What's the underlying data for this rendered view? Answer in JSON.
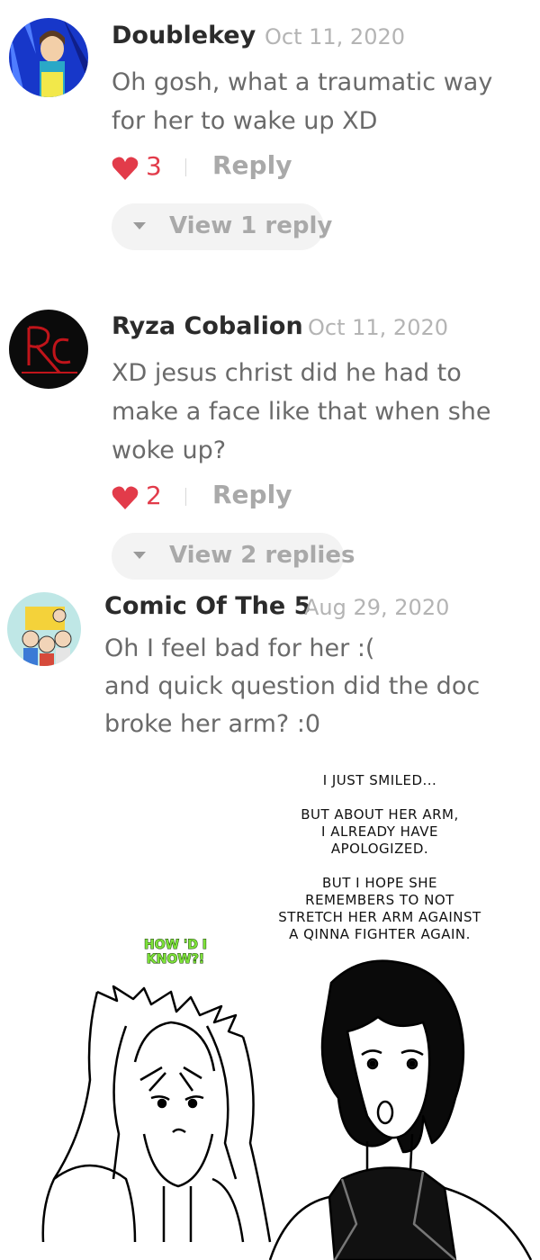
{
  "comments": [
    {
      "author": "Doublekey",
      "date": "Oct 11, 2020",
      "lines": [
        "Oh gosh, what a traumatic way",
        "for her to wake up XD"
      ],
      "likes": "3",
      "reply_label": "Reply",
      "view_replies": "View 1 reply"
    },
    {
      "author": "Ryza Cobalion",
      "date": "Oct 11, 2020",
      "lines": [
        "XD jesus christ did he had to",
        "make a face like that when she",
        "woke up?"
      ],
      "likes": "2",
      "reply_label": "Reply",
      "view_replies": "View 2 replies"
    },
    {
      "author": "Comic Of The 5",
      "date": "Aug 29, 2020",
      "lines": [
        "Oh I feel bad for her :(",
        "and quick question did the doc",
        "broke her arm? :0"
      ]
    }
  ],
  "manga": {
    "speech_lines": [
      "I JUST SMILED...",
      "",
      "BUT ABOUT HER ARM,",
      "I ALREADY HAVE",
      "APOLOGIZED.",
      "",
      "BUT I HOPE SHE",
      "REMEMBERS TO NOT",
      "STRETCH HER ARM AGAINST",
      "A QINNA FIGHTER AGAIN."
    ],
    "shout_lines": [
      "HOW 'D I",
      "KNOW?!"
    ]
  },
  "colors": {
    "like": "#e23b4a",
    "shout": "#7ee23a"
  }
}
